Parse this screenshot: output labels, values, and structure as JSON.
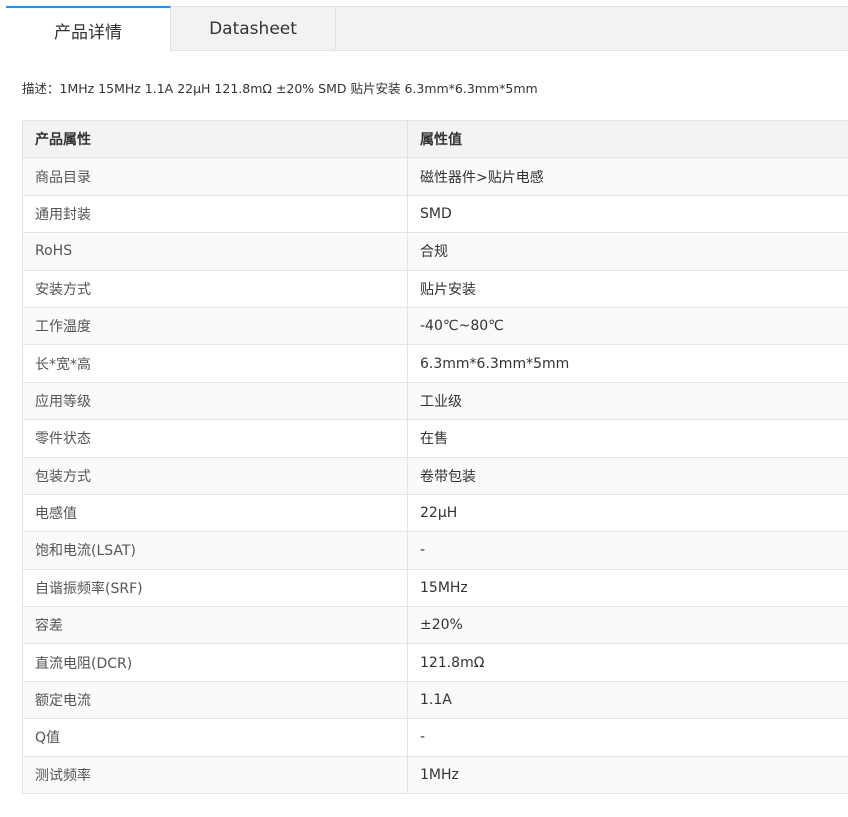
{
  "tabs": [
    {
      "label": "产品详情",
      "active": true
    },
    {
      "label": "Datasheet",
      "active": false
    }
  ],
  "description": "描述：1MHz 15MHz 1.1A 22μH 121.8mΩ ±20% SMD 贴片安装 6.3mm*6.3mm*5mm",
  "table": {
    "headers": [
      "产品属性",
      "属性值"
    ],
    "rows": [
      {
        "key": "商品目录",
        "value": "磁性器件>贴片电感"
      },
      {
        "key": "通用封装",
        "value": "SMD"
      },
      {
        "key": "RoHS",
        "value": "合规"
      },
      {
        "key": "安装方式",
        "value": "贴片安装"
      },
      {
        "key": "工作温度",
        "value": "-40℃~80℃"
      },
      {
        "key": "长*宽*高",
        "value": "6.3mm*6.3mm*5mm"
      },
      {
        "key": "应用等级",
        "value": "工业级"
      },
      {
        "key": "零件状态",
        "value": "在售"
      },
      {
        "key": "包装方式",
        "value": "卷带包装"
      },
      {
        "key": "电感值",
        "value": "22μH"
      },
      {
        "key": "饱和电流(LSAT)",
        "value": "-"
      },
      {
        "key": "自谐振频率(SRF)",
        "value": "15MHz"
      },
      {
        "key": "容差",
        "value": "±20%"
      },
      {
        "key": "直流电阻(DCR)",
        "value": "121.8mΩ"
      },
      {
        "key": "额定电流",
        "value": "1.1A"
      },
      {
        "key": "Q值",
        "value": "-"
      },
      {
        "key": "测试频率",
        "value": "1MHz"
      }
    ]
  },
  "colors": {
    "tab_accent": "#1e90ff",
    "header_bg": "#f3f3f3",
    "border": "#e4e4e4"
  }
}
